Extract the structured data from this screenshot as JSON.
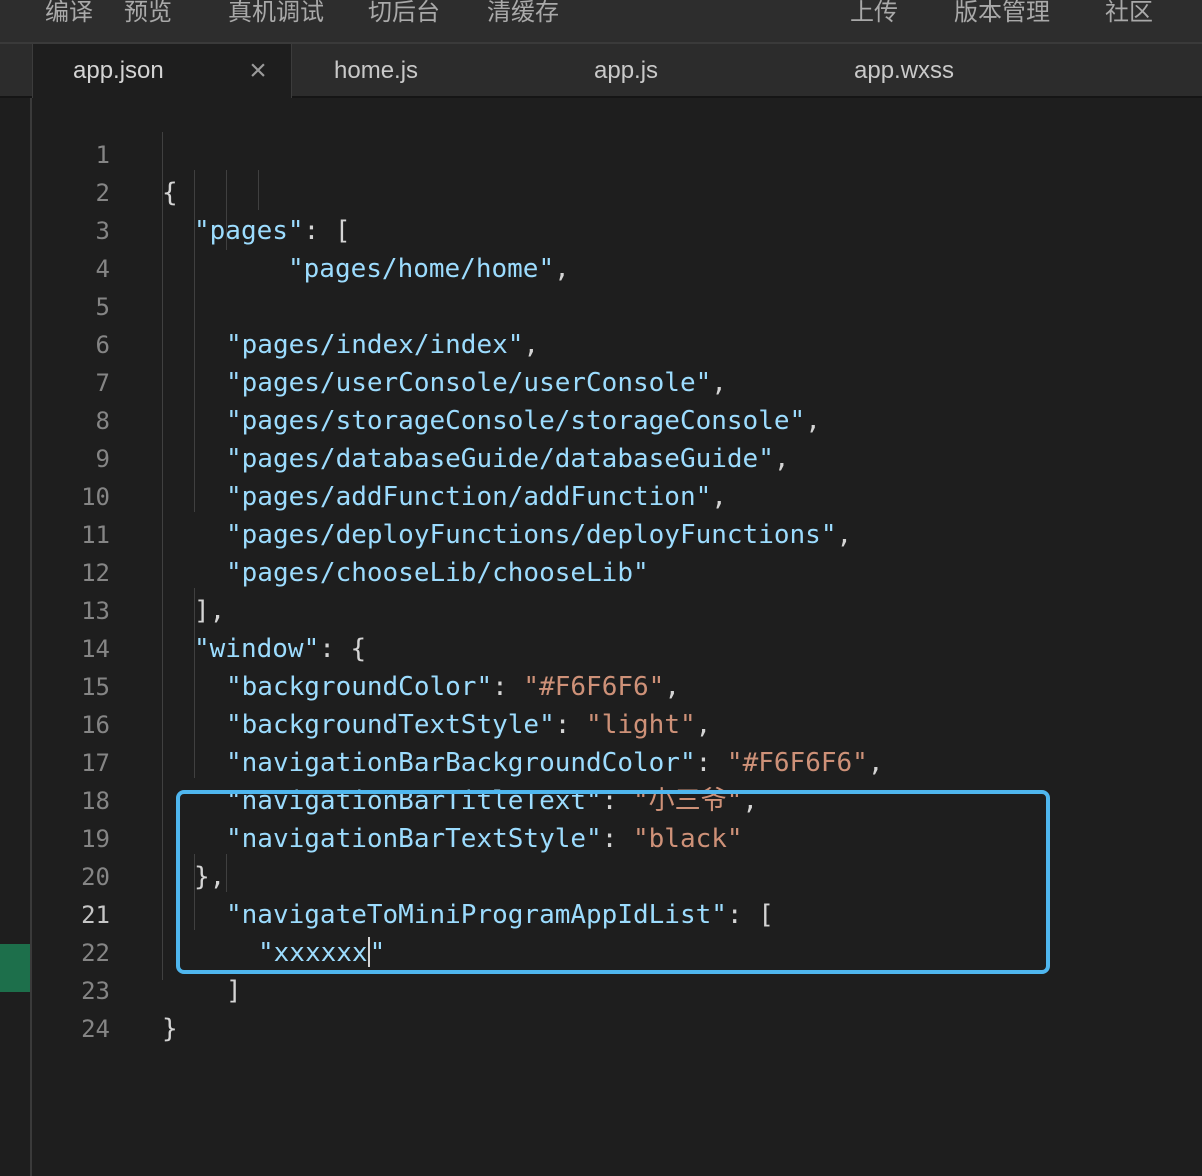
{
  "toolbar": {
    "left": [
      "编译",
      "预览",
      "真机调试",
      "切后台",
      "清缓存"
    ],
    "right": [
      "上传",
      "版本管理",
      "社区"
    ]
  },
  "tabs": {
    "active": "app.json",
    "others": [
      "home.js",
      "app.js",
      "app.wxss"
    ]
  },
  "editor": {
    "line_numbers": [
      "1",
      "2",
      "3",
      "4",
      "5",
      "6",
      "7",
      "8",
      "9",
      "10",
      "11",
      "12",
      "13",
      "14",
      "15",
      "16",
      "17",
      "18",
      "19",
      "20",
      "21",
      "22",
      "23",
      "24"
    ],
    "current_line": "21",
    "code": {
      "l1_brace": "{",
      "l2_key": "\"pages\"",
      "l2_rest": ": [",
      "l3_val": "\"pages/home/home\"",
      "l3_comma": ",",
      "l5_val": "\"pages/index/index\"",
      "l6_val": "\"pages/userConsole/userConsole\"",
      "l7_val": "\"pages/storageConsole/storageConsole\"",
      "l8_val": "\"pages/databaseGuide/databaseGuide\"",
      "l9_val": "\"pages/addFunction/addFunction\"",
      "l10_val": "\"pages/deployFunctions/deployFunctions\"",
      "l11_val": "\"pages/chooseLib/chooseLib\"",
      "comma": ",",
      "l12": "],",
      "l13_key": "\"window\"",
      "l13_rest": ": {",
      "l14_key": "\"backgroundColor\"",
      "l14_val": "\"#F6F6F6\"",
      "l15_key": "\"backgroundTextStyle\"",
      "l15_val": "\"light\"",
      "l16_key": "\"navigationBarBackgroundColor\"",
      "l16_val": "\"#F6F6F6\"",
      "l17_key": "\"navigationBarTitleText\"",
      "l17_val": "\"小三爷\"",
      "l18_key": "\"navigationBarTextStyle\"",
      "l18_val": "\"black\"",
      "colon": ": ",
      "l19": "},",
      "l20_key": "\"navigateToMiniProgramAppIdList\"",
      "l20_rest": ": [",
      "l21_val": "\"xxxxxx",
      "l21_end": "\"",
      "l22": "]",
      "l23": "}"
    }
  }
}
